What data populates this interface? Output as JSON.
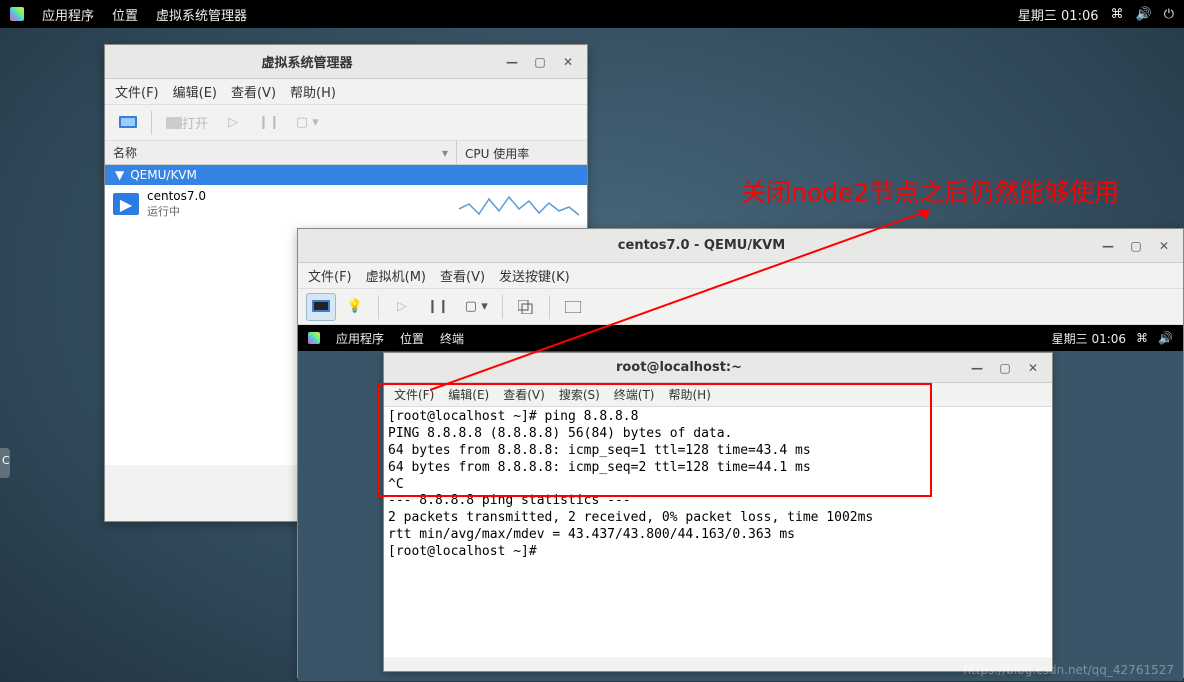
{
  "host_topbar": {
    "apps": "应用程序",
    "places": "位置",
    "activewin": "虚拟系统管理器",
    "clock": "星期三 01:06"
  },
  "vmm": {
    "title": "虚拟系统管理器",
    "menu": {
      "file": "文件(F)",
      "edit": "编辑(E)",
      "view": "查看(V)",
      "help": "帮助(H)"
    },
    "toolbar": {
      "open": "打开"
    },
    "cols": {
      "name": "名称",
      "cpu": "CPU 使用率"
    },
    "group": "QEMU/KVM",
    "vm": {
      "name": "centos7.0",
      "state": "运行中"
    }
  },
  "qemu": {
    "title": "centos7.0 - QEMU/KVM",
    "menu": {
      "file": "文件(F)",
      "vm": "虚拟机(M)",
      "view": "查看(V)",
      "sendkey": "发送按键(K)"
    },
    "guest_topbar": {
      "apps": "应用程序",
      "places": "位置",
      "term": "终端",
      "clock": "星期三 01:06"
    }
  },
  "term": {
    "title": "root@localhost:~",
    "menu": {
      "file": "文件(F)",
      "edit": "编辑(E)",
      "view": "查看(V)",
      "search": "搜索(S)",
      "terminal": "终端(T)",
      "help": "帮助(H)"
    },
    "lines": [
      "[root@localhost ~]# ping 8.8.8.8",
      "PING 8.8.8.8 (8.8.8.8) 56(84) bytes of data.",
      "64 bytes from 8.8.8.8: icmp_seq=1 ttl=128 time=43.4 ms",
      "64 bytes from 8.8.8.8: icmp_seq=2 ttl=128 time=44.1 ms",
      "^C",
      "--- 8.8.8.8 ping statistics ---",
      "2 packets transmitted, 2 received, 0% packet loss, time 1002ms",
      "rtt min/avg/max/mdev = 43.437/43.800/44.163/0.363 ms",
      "[root@localhost ~]# "
    ]
  },
  "annotation": "关闭node2节点之后仍然能够使用",
  "watermark": "https://blog.csdn.net/qq_42761527",
  "dock_label": "C"
}
